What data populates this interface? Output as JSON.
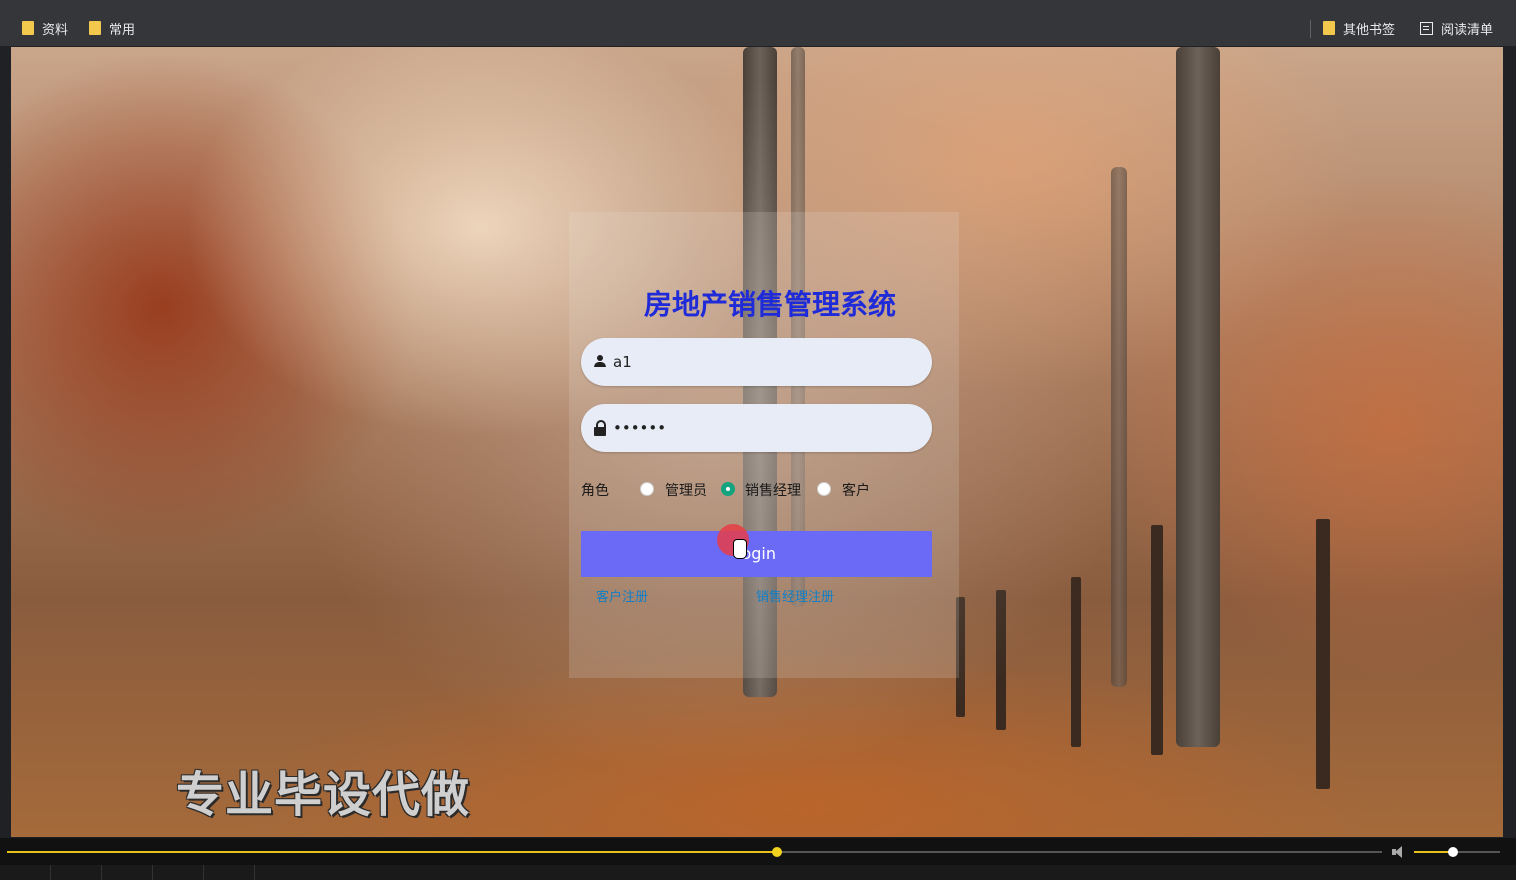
{
  "bookmarks_bar": {
    "items": [
      {
        "label": "资料",
        "icon": "folder-icon"
      },
      {
        "label": "常用",
        "icon": "folder-icon"
      }
    ],
    "other_bookmarks": "其他书签",
    "reading_list": "阅读清单"
  },
  "login": {
    "title": "房地产销售管理系统",
    "username_value": "a1",
    "password_value": "••••••",
    "role_label": "角色",
    "roles": [
      {
        "label": "管理员",
        "checked": false
      },
      {
        "label": "销售经理",
        "checked": true
      },
      {
        "label": "客户",
        "checked": false
      }
    ],
    "login_button": "login",
    "links": {
      "customer_register": "客户注册",
      "sales_manager_register": "销售经理注册"
    }
  },
  "watermark": "专业毕设代做",
  "player": {
    "progress": 0.56,
    "volume": 0.45,
    "accent_color": "#f2d21f"
  },
  "colors": {
    "title": "#1f2ad8",
    "button": "#6a6af6",
    "radio_checked": "#14a37f",
    "link": "#0f7fc9"
  }
}
